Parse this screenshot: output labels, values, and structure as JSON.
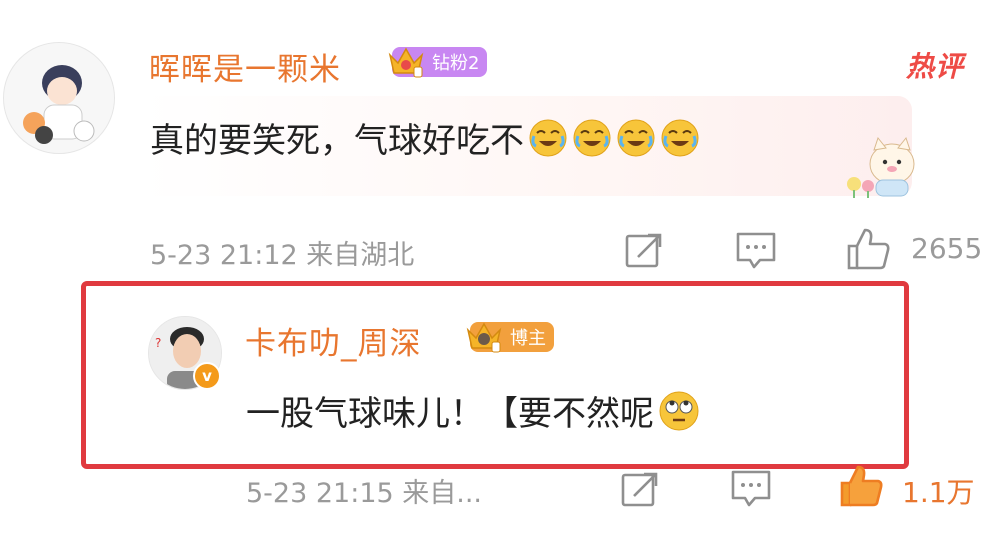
{
  "comments": [
    {
      "username": "晖晖是一颗米",
      "badge_label": "钻粉2",
      "hot_tag": "热评",
      "text": "真的要笑死，气球好吃不",
      "emoji_icons": [
        "laugh-cry-icon",
        "laugh-cry-icon",
        "laugh-cry-icon",
        "laugh-cry-icon"
      ],
      "meta": "5-23 21:12 来自湖北",
      "like_count": "2655"
    },
    {
      "username": "卡布叻_周深",
      "badge_label": "博主",
      "text": "一股气球味儿！【要不然呢",
      "emoji_icons": [
        "eye-roll-icon"
      ],
      "meta": "5-23 21:15 来自...",
      "like_count": "1.1万",
      "verified_mark": "v"
    }
  ],
  "colors": {
    "username": "#e8762f",
    "highlight_border": "#e03a3f",
    "hot_tag": "#ee4b46",
    "meta_text": "#9a9a9a"
  }
}
